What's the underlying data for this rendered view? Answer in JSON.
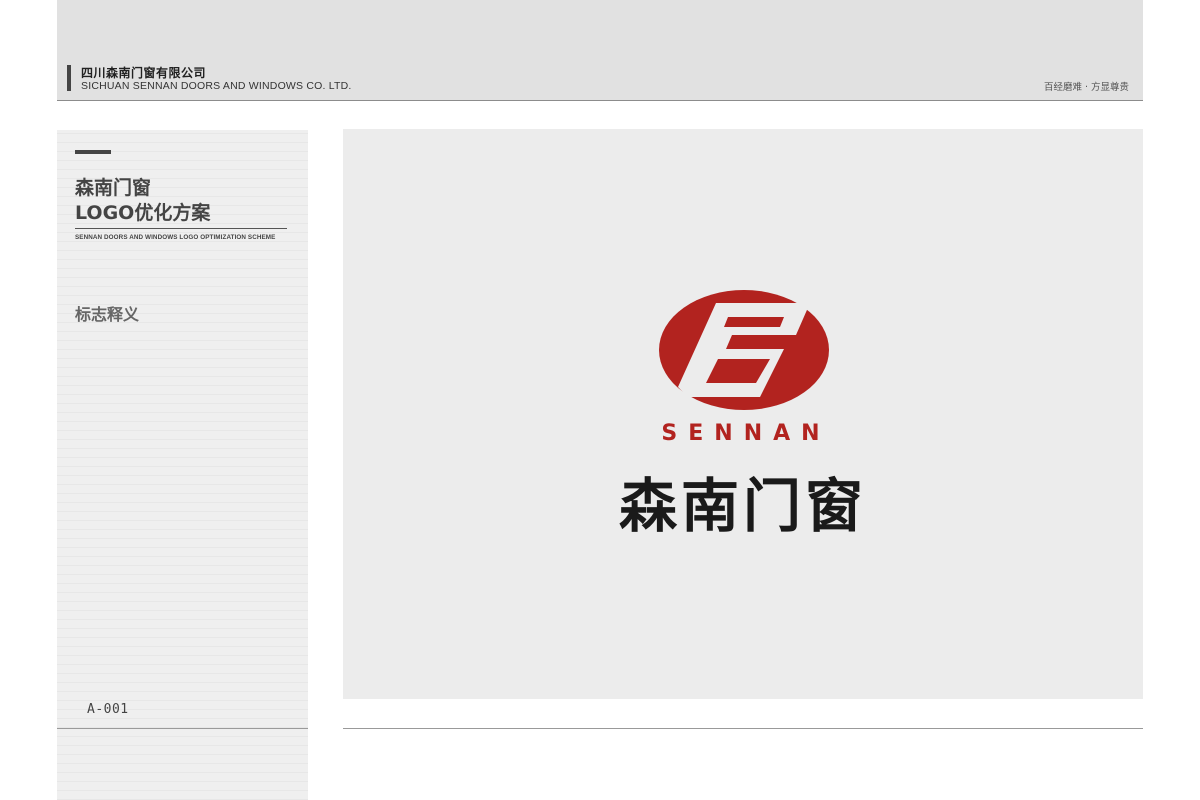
{
  "header": {
    "company_cn": "四川森南门窗有限公司",
    "company_en": "SICHUAN SENNAN DOORS AND WINDOWS CO. LTD.",
    "slogan": "百经磨难 · 方显尊贵"
  },
  "sidebar": {
    "title_line1": "森南门窗",
    "title_line2": "LOGO优化方案",
    "subtitle": "SENNAN DOORS AND WINDOWS LOGO OPTIMIZATION SCHEME",
    "section_label": "标志释义",
    "page_code": "A-001"
  },
  "logo": {
    "icon": "sennan-s-emblem-icon",
    "wordmark_en": "SENNAN",
    "wordmark_cn": "森南门窗",
    "colors": {
      "brand_red": "#b2231f",
      "text_black": "#1a1a1a"
    }
  }
}
